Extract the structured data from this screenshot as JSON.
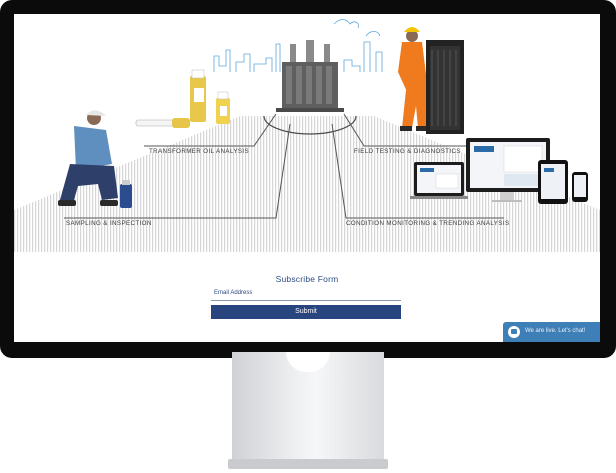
{
  "hero": {
    "labels": {
      "transformer_oil": "TRANSFORMER OIL ANALYSIS",
      "field_testing": "FIELD TESTING & DIAGNOSTICS",
      "sampling": "SAMPLING & INSPECTION",
      "condition_monitoring": "CONDITION MONITORING & TRENDING ANALYSIS"
    }
  },
  "subscribe": {
    "title": "Subscribe Form",
    "email_label": "Email Address",
    "submit_label": "Submit"
  },
  "chat": {
    "text": "We are live. Let's chat!"
  },
  "colors": {
    "accent": "#29457f",
    "chat": "#3e7fb8"
  }
}
